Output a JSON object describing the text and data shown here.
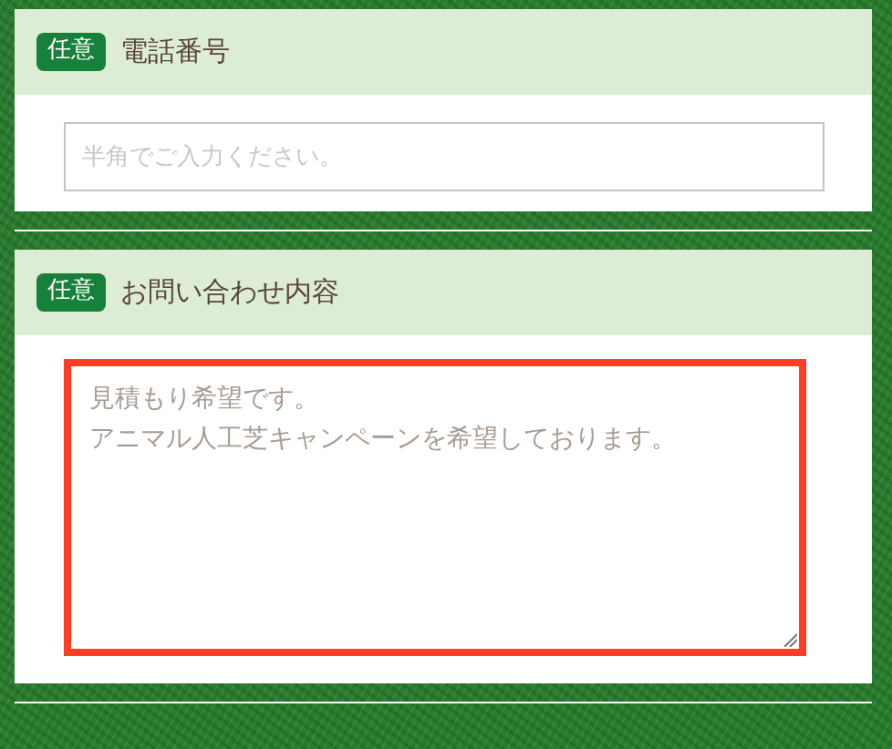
{
  "fields": [
    {
      "kind": "input",
      "badge": "任意",
      "label": "電話番号",
      "placeholder": "半角でご入力ください。",
      "highlighted": false
    },
    {
      "kind": "textarea",
      "badge": "任意",
      "label": "お問い合わせ内容",
      "lines": [
        "見積もり希望です。",
        "アニマル人工芝キャンペーンを希望しております。"
      ],
      "highlighted": true
    }
  ]
}
